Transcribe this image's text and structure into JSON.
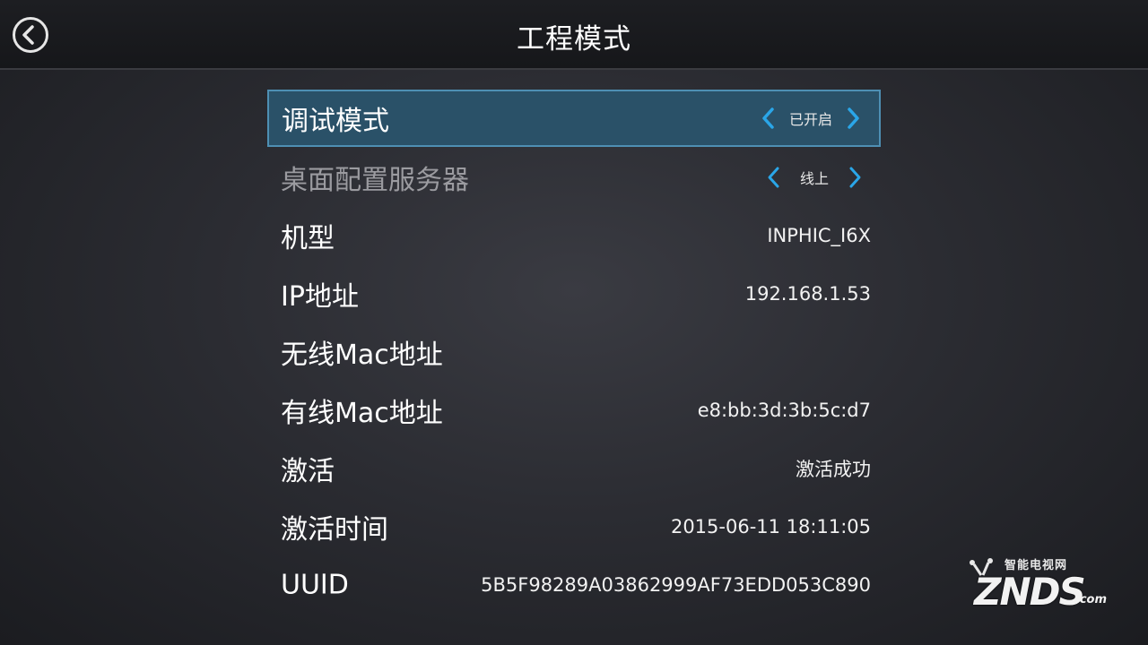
{
  "header": {
    "title": "工程模式",
    "back_icon": "back-arrow-circle-icon"
  },
  "rows": [
    {
      "label": "调试模式",
      "value": "已开启",
      "type": "selector",
      "focused": true
    },
    {
      "label": "桌面配置服务器",
      "value": "线上",
      "type": "selector",
      "focused": false
    },
    {
      "label": "机型",
      "value": "INPHIC_I6X"
    },
    {
      "label": "IP地址",
      "value": "192.168.1.53"
    },
    {
      "label": "无线Mac地址",
      "value": ""
    },
    {
      "label": "有线Mac地址",
      "value": "e8:bb:3d:3b:5c:d7"
    },
    {
      "label": "激活",
      "value": "激活成功"
    },
    {
      "label": "激活时间",
      "value": "2015-06-11 18:11:05"
    },
    {
      "label": "UUID",
      "value": "5B5F98289A03862999AF73EDD053C890"
    }
  ],
  "watermark": {
    "top_text": "智能电视网",
    "brand": "ZNDS",
    "suffix": ".com"
  },
  "colors": {
    "focus_bg": "#2a5168",
    "focus_border": "#4e8fb3",
    "arrow": "#2aa6e8"
  }
}
